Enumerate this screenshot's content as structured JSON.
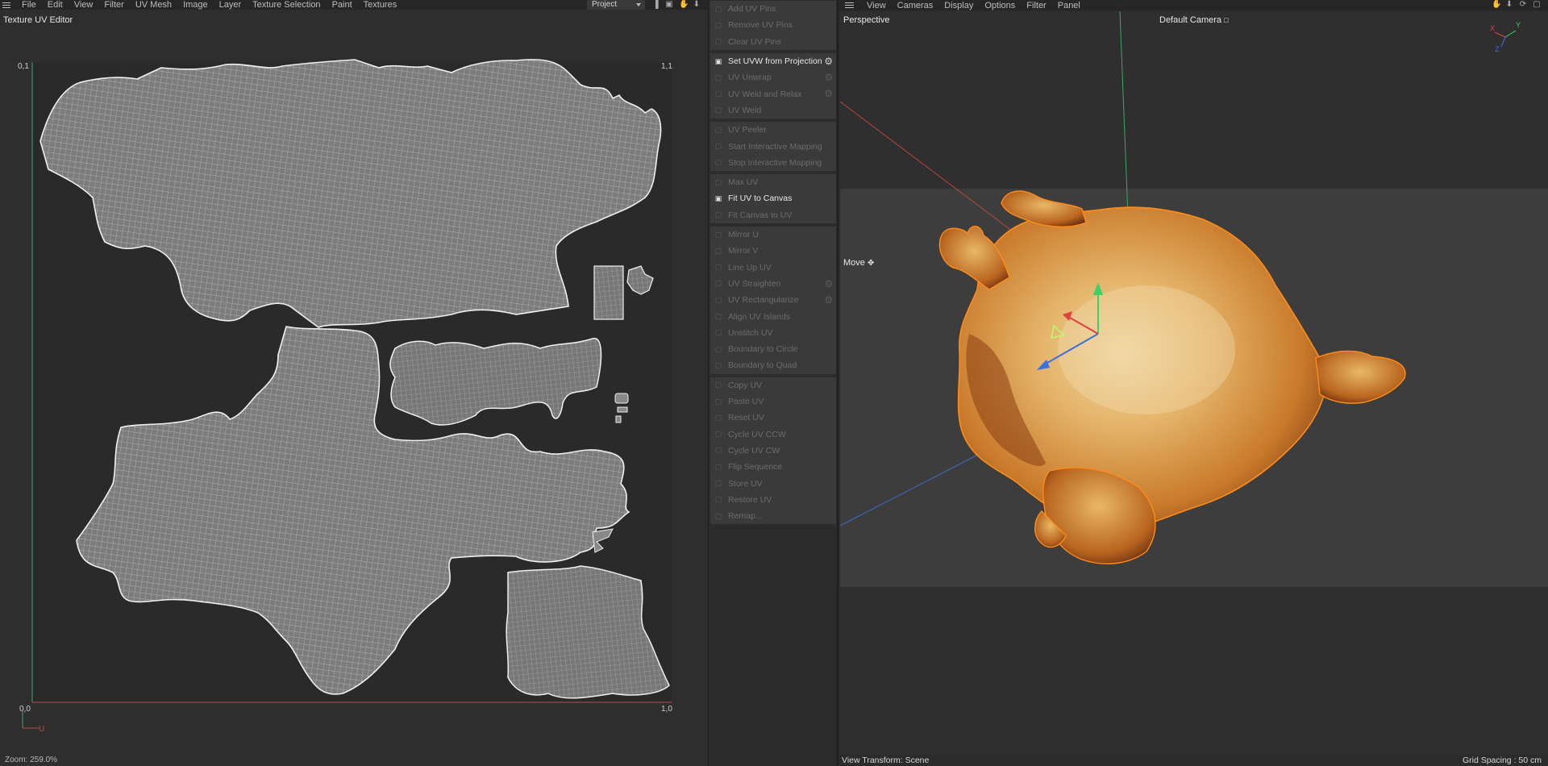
{
  "uv_editor": {
    "menubar": [
      "File",
      "Edit",
      "View",
      "Filter",
      "UV Mesh",
      "Image",
      "Layer",
      "Texture Selection",
      "Paint",
      "Textures"
    ],
    "project_dropdown": "Project",
    "title": "Texture UV Editor",
    "corners": {
      "top_left": "0,1",
      "top_right": "1,1",
      "bottom_left": "0,0",
      "bottom_right": "1,0"
    },
    "axis_u": "U",
    "status": "Zoom: 259.0%"
  },
  "uv_commands": {
    "groups": [
      [
        {
          "label": "Add UV Pins",
          "enabled": false,
          "gear": false,
          "icon": "pin-icon"
        },
        {
          "label": "Remove UV Pins",
          "enabled": false,
          "gear": false,
          "icon": "pin-icon"
        },
        {
          "label": "Clear UV Pins",
          "enabled": false,
          "gear": false,
          "icon": "close-icon"
        }
      ],
      [
        {
          "label": "Set UVW from Projection",
          "enabled": true,
          "gear": true,
          "icon": "projection-icon"
        },
        {
          "label": "UV Unwrap",
          "enabled": false,
          "gear": true,
          "icon": "unwrap-icon"
        },
        {
          "label": "UV Weld and Relax",
          "enabled": false,
          "gear": true,
          "icon": "weld-relax-icon"
        },
        {
          "label": "UV Weld",
          "enabled": false,
          "gear": false,
          "icon": "weld-icon"
        }
      ],
      [
        {
          "label": "UV Peeler",
          "enabled": false,
          "gear": false,
          "icon": "peeler-icon"
        },
        {
          "label": "Start Interactive Mapping",
          "enabled": false,
          "gear": false,
          "icon": "play-icon"
        },
        {
          "label": "Stop Interactive Mapping",
          "enabled": false,
          "gear": false,
          "icon": "stop-icon"
        }
      ],
      [
        {
          "label": "Max UV",
          "enabled": false,
          "gear": false,
          "icon": "max-icon"
        },
        {
          "label": "Fit UV to Canvas",
          "enabled": true,
          "gear": false,
          "icon": "fit-icon"
        },
        {
          "label": "Fit Canvas to UV",
          "enabled": false,
          "gear": false,
          "icon": "fit-canvas-icon"
        }
      ],
      [
        {
          "label": "Mirror U",
          "enabled": false,
          "gear": false,
          "icon": "mirror-u-icon"
        },
        {
          "label": "Mirror V",
          "enabled": false,
          "gear": false,
          "icon": "mirror-v-icon"
        },
        {
          "label": "Line Up UV",
          "enabled": false,
          "gear": false,
          "icon": "line-up-icon"
        },
        {
          "label": "UV Straighten",
          "enabled": false,
          "gear": true,
          "icon": "straighten-icon"
        },
        {
          "label": "UV Rectangularize",
          "enabled": false,
          "gear": true,
          "icon": "rectangularize-icon"
        },
        {
          "label": "Align UV Islands",
          "enabled": false,
          "gear": false,
          "icon": "align-icon"
        },
        {
          "label": "Unstitch UV",
          "enabled": false,
          "gear": false,
          "icon": "unstitch-icon"
        },
        {
          "label": "Boundary to Circle",
          "enabled": false,
          "gear": false,
          "icon": "circle-icon"
        },
        {
          "label": "Boundary to Quad",
          "enabled": false,
          "gear": false,
          "icon": "quad-icon"
        }
      ],
      [
        {
          "label": "Copy UV",
          "enabled": false,
          "gear": false,
          "icon": "copy-icon"
        },
        {
          "label": "Paste UV",
          "enabled": false,
          "gear": false,
          "icon": "paste-icon"
        },
        {
          "label": "Reset UV",
          "enabled": false,
          "gear": false,
          "icon": "reset-icon"
        },
        {
          "label": "Cycle UV CCW",
          "enabled": false,
          "gear": false,
          "icon": "cycle-ccw-icon"
        },
        {
          "label": "Cycle UV CW",
          "enabled": false,
          "gear": false,
          "icon": "cycle-cw-icon"
        },
        {
          "label": "Flip Sequence",
          "enabled": false,
          "gear": false,
          "icon": "flip-icon"
        },
        {
          "label": "Store UV",
          "enabled": false,
          "gear": false,
          "icon": "store-icon"
        },
        {
          "label": "Restore UV",
          "enabled": false,
          "gear": false,
          "icon": "restore-icon"
        },
        {
          "label": "Remap...",
          "enabled": false,
          "gear": false,
          "icon": "remap-icon"
        }
      ]
    ]
  },
  "viewport": {
    "menubar": [
      "View",
      "Cameras",
      "Display",
      "Options",
      "Filter",
      "Panel"
    ],
    "view_label": "Perspective",
    "camera_label": "Default Camera",
    "tool_label": "Move",
    "axis_labels": {
      "x": "X",
      "y": "Y",
      "z": "Z"
    },
    "view_transform": "View Transform: Scene",
    "grid_spacing": "Grid Spacing : 50 cm"
  },
  "colors": {
    "panel_bg": "#2e2e2e",
    "uv_canvas": "#2a2a2a",
    "uv_island_fill": "#7c7c7c",
    "uv_island_edge": "#f0f0f0",
    "axis_v": "#3aa86a",
    "axis_u": "#c8463c",
    "floor": "#3d3d3d",
    "chicken_skin": "#d89640",
    "selection_outline": "#ff8c1a"
  }
}
